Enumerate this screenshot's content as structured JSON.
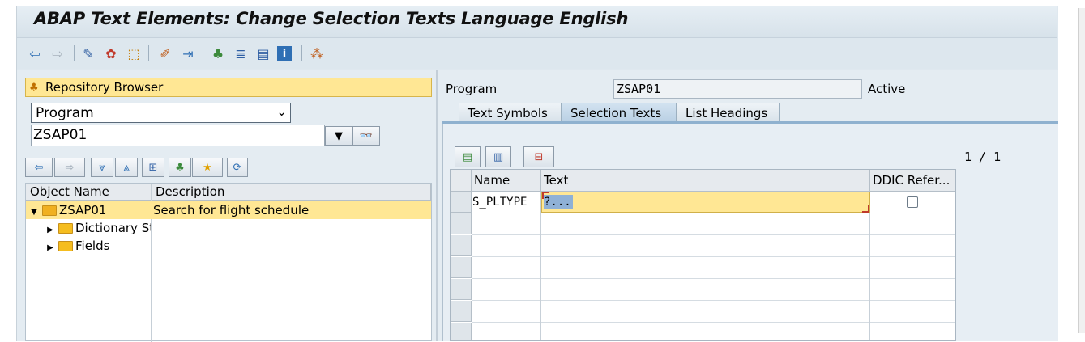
{
  "window": {
    "title": "ABAP Text Elements: Change Selection Texts Language English"
  },
  "toolbar": {
    "icons": [
      "back-arrow-icon",
      "forward-arrow-icon",
      "other-object-icon",
      "check-icon",
      "activate-icon",
      "where-used-icon",
      "pretty-print-icon",
      "object-list-icon",
      "navigation-window-icon",
      "display-object-list-icon",
      "info-icon",
      "enhance-icon"
    ]
  },
  "repository": {
    "browser_label": "Repository Browser",
    "object_type": "Program",
    "object_name": "ZSAP01",
    "tree_headers": {
      "object_name": "Object Name",
      "description": "Description"
    },
    "tree_items": [
      {
        "label": "ZSAP01",
        "description": "Search for flight schedule"
      },
      {
        "label": "Dictionary St",
        "description": ""
      },
      {
        "label": "Fields",
        "description": ""
      }
    ]
  },
  "header": {
    "program_label": "Program",
    "program_value": "ZSAP01",
    "status": "Active"
  },
  "tabs": [
    {
      "label": "Text Symbols",
      "active": false
    },
    {
      "label": "Selection Texts",
      "active": true
    },
    {
      "label": "List Headings",
      "active": false
    }
  ],
  "table": {
    "page_indicator": "1 / 1",
    "columns": [
      "Name",
      "Text",
      "DDIC Refer..."
    ],
    "rows": [
      {
        "name": "S_PLTYPE",
        "text": "?...",
        "ddic": false
      }
    ]
  },
  "colors": {
    "accent_yellow": "#ffe794",
    "frame_blue": "#dfe8ef",
    "tab_active": "#b9d0e4"
  }
}
